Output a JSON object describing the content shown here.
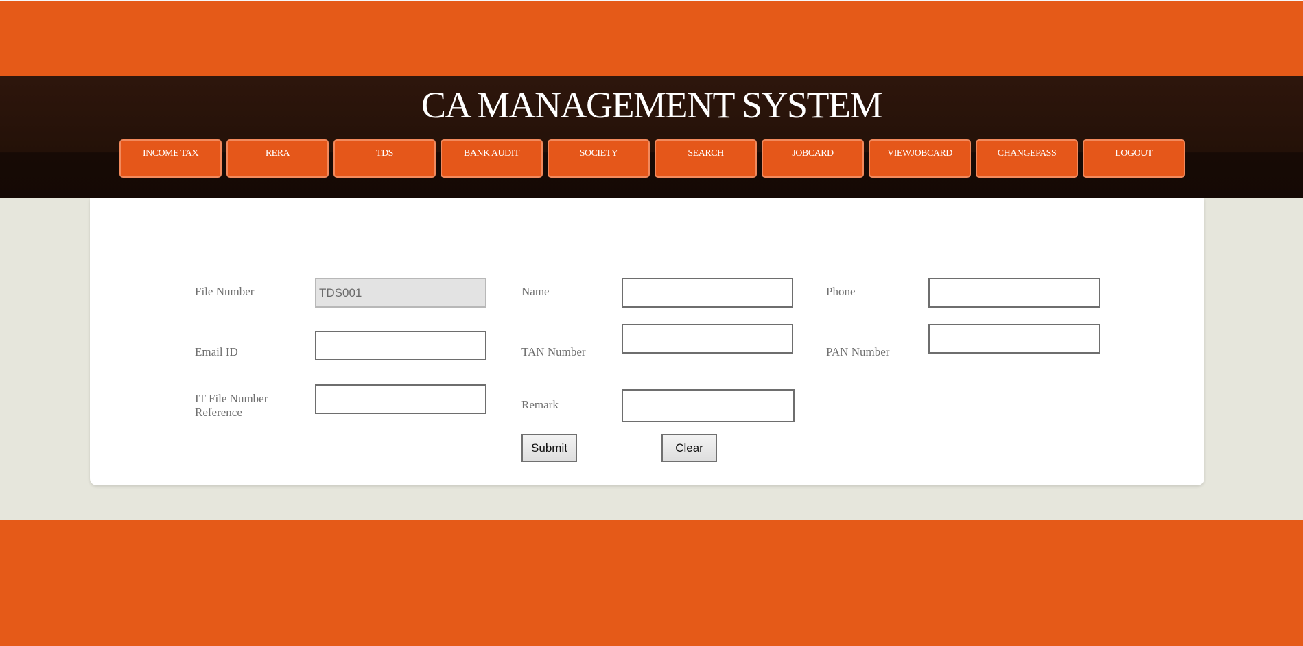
{
  "header": {
    "title": "CA MANAGEMENT SYSTEM"
  },
  "nav": {
    "items": [
      {
        "label": "INCOME TAX"
      },
      {
        "label": "RERA"
      },
      {
        "label": "TDS"
      },
      {
        "label": "BANK AUDIT"
      },
      {
        "label": "SOCIETY"
      },
      {
        "label": "SEARCH"
      },
      {
        "label": "JOBCARD"
      },
      {
        "label": "VIEWJOBCARD"
      },
      {
        "label": "CHANGEPASS"
      },
      {
        "label": "LOGOUT"
      }
    ]
  },
  "form": {
    "file_number": {
      "label": "File Number",
      "value": "TDS001"
    },
    "name": {
      "label": "Name",
      "value": ""
    },
    "phone": {
      "label": "Phone",
      "value": ""
    },
    "email": {
      "label": "Email ID",
      "value": ""
    },
    "tan": {
      "label": "TAN Number",
      "value": ""
    },
    "pan": {
      "label": "PAN Number",
      "value": ""
    },
    "it_file_ref": {
      "label_line1": "IT File Number",
      "label_line2": "Reference",
      "value": ""
    },
    "remark": {
      "label": "Remark",
      "value": ""
    },
    "submit_label": "Submit",
    "clear_label": "Clear"
  },
  "colors": {
    "accent": "#e55a18",
    "header_bg": "#241108",
    "page_bg": "#e6e6dc"
  }
}
